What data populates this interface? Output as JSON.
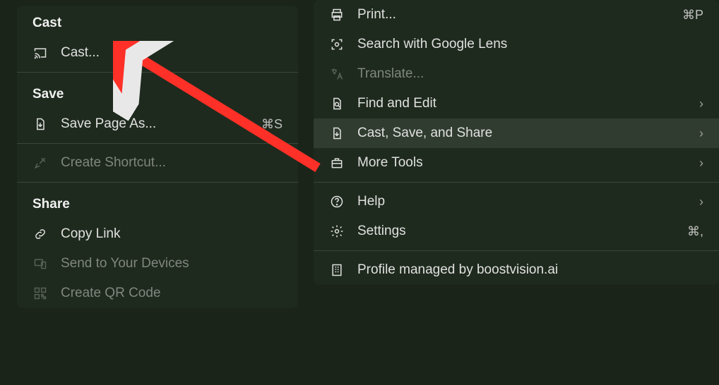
{
  "submenu": {
    "sections": [
      {
        "header": "Cast",
        "items": [
          {
            "id": "cast",
            "label": "Cast...",
            "enabled": true
          }
        ]
      },
      {
        "header": "Save",
        "items": [
          {
            "id": "save-page-as",
            "label": "Save Page As...",
            "enabled": true,
            "shortcut": "⌘S"
          },
          {
            "id": "create-shortcut",
            "label": "Create Shortcut...",
            "enabled": false
          }
        ]
      },
      {
        "header": "Share",
        "items": [
          {
            "id": "copy-link",
            "label": "Copy Link",
            "enabled": true
          },
          {
            "id": "send-to-devices",
            "label": "Send to Your Devices",
            "enabled": false
          },
          {
            "id": "create-qr",
            "label": "Create QR Code",
            "enabled": false
          }
        ]
      }
    ]
  },
  "mainmenu": {
    "groups": [
      [
        {
          "id": "print",
          "label": "Print...",
          "shortcut": "⌘P",
          "enabled": true
        },
        {
          "id": "search-lens",
          "label": "Search with Google Lens",
          "enabled": true
        },
        {
          "id": "translate",
          "label": "Translate...",
          "enabled": false
        },
        {
          "id": "find-edit",
          "label": "Find and Edit",
          "enabled": true,
          "submenu": true
        },
        {
          "id": "cast-save-share",
          "label": "Cast, Save, and Share",
          "enabled": true,
          "submenu": true,
          "highlighted": true
        },
        {
          "id": "more-tools",
          "label": "More Tools",
          "enabled": true,
          "submenu": true
        }
      ],
      [
        {
          "id": "help",
          "label": "Help",
          "enabled": true,
          "submenu": true
        },
        {
          "id": "settings",
          "label": "Settings",
          "enabled": true,
          "shortcut": "⌘,"
        }
      ],
      [
        {
          "id": "profile-managed",
          "label": "Profile managed by boostvision.ai",
          "enabled": true
        }
      ]
    ]
  }
}
